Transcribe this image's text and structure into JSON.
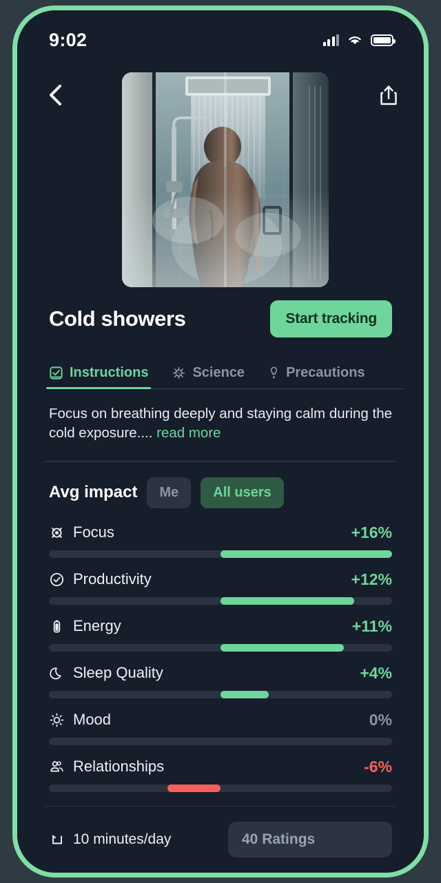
{
  "status_bar": {
    "time": "9:02",
    "signal_icon": "cellular-signal-icon",
    "wifi_icon": "wifi-icon",
    "battery_icon": "battery-icon"
  },
  "header": {
    "back_icon": "chevron-left-icon",
    "share_icon": "share-icon",
    "hero_image_alt": "person taking a cold shower with steam"
  },
  "detail": {
    "title": "Cold showers",
    "start_tracking_label": "Start tracking"
  },
  "tabs": [
    {
      "label": "Instructions",
      "icon": "checklist-icon",
      "active": true
    },
    {
      "label": "Science",
      "icon": "microbe-icon",
      "active": false
    },
    {
      "label": "Precautions",
      "icon": "alert-icon",
      "active": false
    }
  ],
  "description": {
    "text": "Focus on breathing deeply and staying calm during the cold exposure....",
    "read_more_label": "read more"
  },
  "impact": {
    "title": "Avg impact",
    "scopes": [
      {
        "label": "Me",
        "active": false
      },
      {
        "label": "All users",
        "active": true
      }
    ]
  },
  "chart_data": {
    "type": "bar",
    "title": "Avg impact",
    "orientation": "horizontal-diverging",
    "xlabel": "",
    "ylabel": "",
    "xlim": [
      -100,
      100
    ],
    "unit": "%",
    "grid": false,
    "legend": "none",
    "categories": [
      "Focus",
      "Productivity",
      "Energy",
      "Sleep Quality",
      "Mood",
      "Relationships"
    ],
    "values": [
      16,
      12,
      11,
      4,
      0,
      -6
    ],
    "labels": [
      "+16%",
      "+12%",
      "+11%",
      "+4%",
      "0%",
      "-6%"
    ],
    "bar_fill_percent_of_half": [
      100,
      78,
      72,
      28,
      0,
      31
    ],
    "colors": {
      "positive": "#6ed69a",
      "negative": "#f8615a",
      "zero": "#8c94a3",
      "track": "#2b3342"
    },
    "icons": [
      "target-icon",
      "check-circle-icon",
      "battery-icon",
      "moon-icon",
      "sun-icon",
      "people-icon"
    ]
  },
  "footer": {
    "duration_icon": "clock-icon",
    "duration_label": "10 minutes/day",
    "ratings_label": "40 Ratings"
  },
  "theme": {
    "accent": "#6ed69a",
    "bezel": "#7fdfa4",
    "background": "#161d2b",
    "page_background": "#2e3b43",
    "negative": "#f8615a",
    "muted": "#8c94a3"
  }
}
